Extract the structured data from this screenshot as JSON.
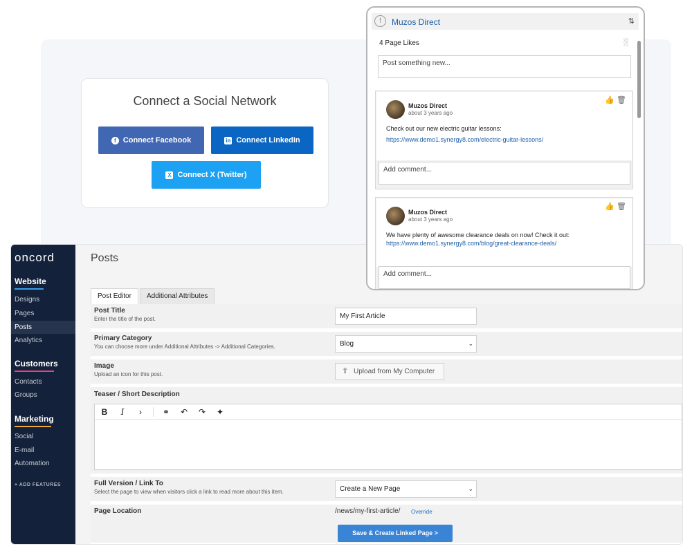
{
  "connect": {
    "title": "Connect a Social Network",
    "facebook_label": "Connect Facebook",
    "linkedin_label": "Connect LinkedIn",
    "x_label": "Connect X (Twitter)"
  },
  "app": {
    "logo": "oncord",
    "sections": [
      {
        "title": "Website",
        "underline_color": "#3aa0e8",
        "items": [
          "Designs",
          "Pages",
          "Posts",
          "Analytics"
        ]
      },
      {
        "title": "Customers",
        "underline_color": "#e0457b",
        "items": [
          "Contacts",
          "Groups"
        ]
      },
      {
        "title": "Marketing",
        "underline_color": "#f2a93b",
        "items": [
          "Social",
          "E-mail",
          "Automation"
        ]
      }
    ],
    "active_item": "Posts",
    "add_features": "+ ADD FEATURES"
  },
  "posts": {
    "page_title": "Posts",
    "tabs": [
      "Post Editor",
      "Additional Attributes"
    ],
    "post_title_label": "Post Title",
    "post_title_hint": "Enter the title of the post.",
    "post_title_value": "My First Article",
    "category_label": "Primary Category",
    "category_hint": "You can choose more under Additional Attributes -> Additional Categories.",
    "category_value": "Blog",
    "image_label": "Image",
    "image_hint": "Upload an icon for this post.",
    "upload_label": "Upload from My Computer",
    "teaser_label": "Teaser / Short Description",
    "full_label": "Full Version / Link To",
    "full_hint": "Select the page to view when visitors click a link to read more about this item.",
    "full_value": "Create a New Page",
    "location_label": "Page Location",
    "location_value": "/news/my-first-article/",
    "override_label": "Override",
    "save_label": "Save & Create Linked Page >"
  },
  "feed": {
    "page_name": "Muzos Direct",
    "likes": "4 Page Likes",
    "post_placeholder": "Post something new...",
    "posts": [
      {
        "author": "Muzos Direct",
        "time": "about 3 years ago",
        "text": "Check out our new electric guitar lessons:",
        "link": "https://www.demo1.synergy8.com/electric-guitar-lessons/",
        "comment_placeholder": "Add comment..."
      },
      {
        "author": "Muzos Direct",
        "time": "about 3 years ago",
        "text": "We have plenty of awesome clearance deals on now! Check it out:",
        "link": "https://www.demo1.synergy8.com/blog/great-clearance-deals/",
        "comment_placeholder": "Add comment..."
      }
    ]
  }
}
